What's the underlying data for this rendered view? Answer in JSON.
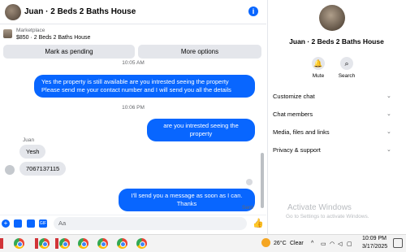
{
  "header": {
    "title": "Juan · 2 Beds 2 Baths House",
    "info_icon": "info-icon"
  },
  "marketplace": {
    "label": "Marketplace",
    "listing": "$850 · 2 Beds 2 Baths House"
  },
  "actions": {
    "pending": "Mark as pending",
    "more": "More options"
  },
  "messages": {
    "top_time": "10:05 AM",
    "out1": "Yes the property is still available are you intrested seeing the property Please send me your contact number and I will send you all the details",
    "time2": "10:06 PM",
    "out2": "are you intrested seeing the property",
    "sender": "Juan",
    "in1": "Yesh",
    "in2": "7067137115",
    "out3": "I'll send you a message as soon as I can. Thanks",
    "status": "Sent"
  },
  "composer": {
    "placeholder": "Aa"
  },
  "panel": {
    "title": "Juan · 2 Beds 2 Baths House",
    "mute": "Mute",
    "search": "Search",
    "rows": [
      "Customize chat",
      "Chat members",
      "Media, files and links",
      "Privacy & support"
    ]
  },
  "watermark": {
    "line1": "Activate Windows",
    "line2": "Go to Settings to activate Windows."
  },
  "taskbar": {
    "temp": "26°C",
    "weather": "Clear",
    "time": "10:09 PM",
    "date": "3/17/2025"
  },
  "colors": {
    "accent": "#0866ff",
    "bubble_in": "#e4e6eb"
  }
}
